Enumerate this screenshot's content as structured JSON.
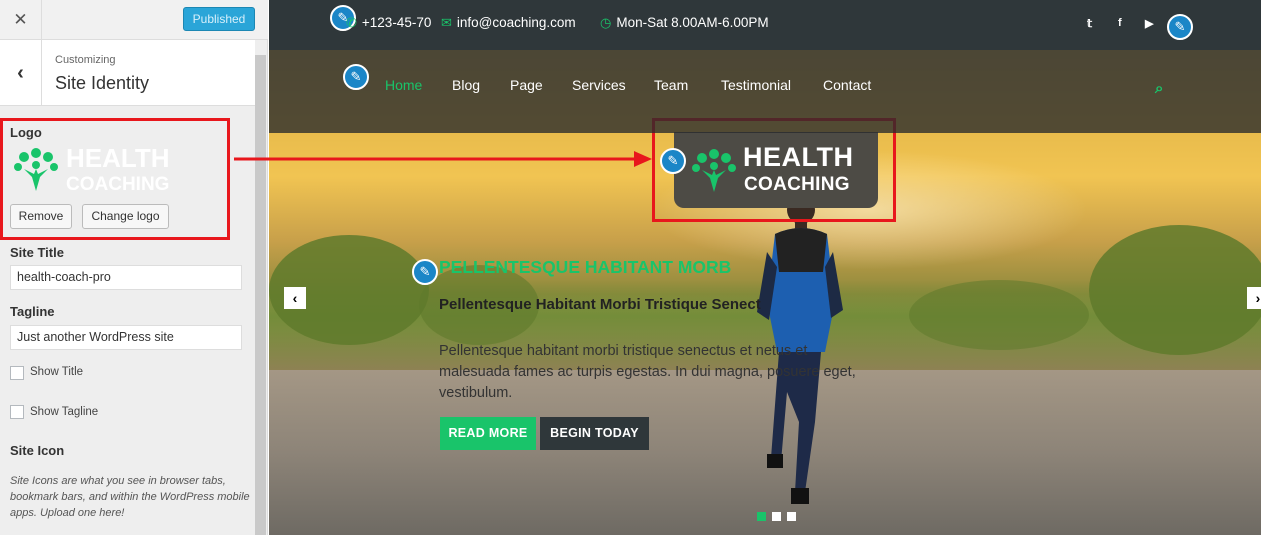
{
  "sidebar": {
    "close_icon": "close-icon",
    "publish_label": "Published",
    "back_icon": "chevron-left-icon",
    "customizing_label": "Customizing",
    "section_title": "Site Identity",
    "logo_label": "Logo",
    "logo_preview": {
      "line1": "HEALTH",
      "line2": "COACHING"
    },
    "remove_label": "Remove",
    "change_logo_label": "Change logo",
    "site_title_label": "Site Title",
    "site_title_value": "health-coach-pro",
    "tagline_label": "Tagline",
    "tagline_value": "Just another WordPress site",
    "show_title_label": "Show Title",
    "show_tagline_label": "Show Tagline",
    "site_icon_label": "Site Icon",
    "site_icon_desc": "Site Icons are what you see in browser tabs, bookmark bars, and within the WordPress mobile apps. Upload one here!"
  },
  "topbar": {
    "phone": "+123-45-70",
    "email": "info@coaching.com",
    "hours": "Mon-Sat 8.00AM-6.00PM",
    "social": [
      "twitter-icon",
      "facebook-icon",
      "youtube-icon"
    ]
  },
  "nav": {
    "items": [
      "Home",
      "Blog",
      "Page",
      "Services",
      "Team",
      "Testimonial",
      "Contact"
    ],
    "active": "Home"
  },
  "logo": {
    "line1": "HEALTH",
    "line2": "COACHING"
  },
  "slide": {
    "heading": "PELLENTESQUE HABITANT MORB",
    "subheading": "Pellentesque Habitant Morbi Tristique Senect",
    "text": "Pellentesque habitant morbi tristique senectus et netus et malesuada fames ac turpis egestas. In dui magna, posuere eget, vestibulum.",
    "read_more": "READ MORE",
    "begin_today": "BEGIN TODAY",
    "dots": 3,
    "active_dot": 1
  },
  "colors": {
    "accent": "#19c46a",
    "topbar": "#2f373a",
    "highlight": "#e8171c",
    "publish": "#2aa5d8"
  }
}
